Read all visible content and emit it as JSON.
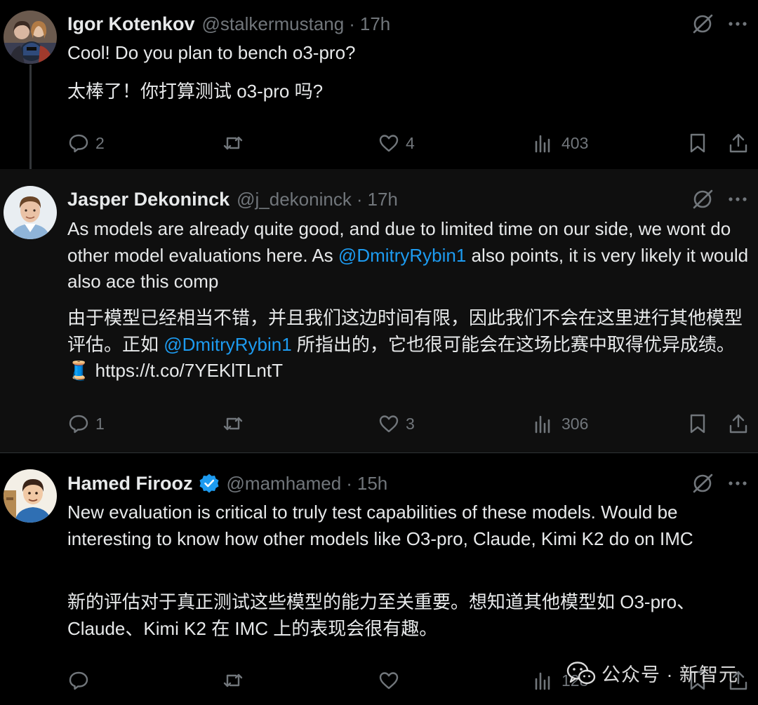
{
  "tweets": [
    {
      "author": "Igor Kotenkov",
      "handle": "@stalkermustang",
      "time": "17h",
      "text_en": "Cool! Do you plan to bench o3-pro?",
      "text_zh": "太棒了！你打算测试 o3-pro 吗?",
      "replies": "2",
      "retweets": "",
      "likes": "4",
      "views": "403"
    },
    {
      "author": "Jasper Dekoninck",
      "handle": "@j_dekoninck",
      "time": "17h",
      "text_en_1": "As models are already quite good, and due to limited time on our side, we wont do other model evaluations here. As",
      "mention_en": "@DmitryRybin1",
      "text_en_2": "also points, it is very likely it would also ace this comp",
      "text_zh_1": "由于模型已经相当不错，并且我们这边时间有限，因此我们不会在这里进行其他模型评估。正如",
      "mention_zh": "@DmitryRybin1",
      "text_zh_2": "所指出的，它也很可能会在这场比赛中取得优异成绩。",
      "emoji": "🧵",
      "link": "https://t.co/7YEKlTLntT",
      "replies": "1",
      "retweets": "",
      "likes": "3",
      "views": "306"
    },
    {
      "author": "Hamed Firooz",
      "handle": "@mamhamed",
      "time": "15h",
      "text_en": "New evaluation is critical to truly test capabilities of these models. Would be interesting to know how other models like O3-pro, Claude, Kimi K2 do on IMC",
      "text_zh": "新的评估对于真正测试这些模型的能力至关重要。想知道其他模型如 O3-pro、Claude、Kimi K2 在 IMC 上的表现会很有趣。",
      "replies": "",
      "retweets": "",
      "likes": "",
      "views": "128"
    }
  ],
  "dot": "·",
  "watermark": "公众号 · 新智元",
  "colors": {
    "background": "#000000",
    "highlight_bg": "#0f0f0f",
    "text": "#e7e9ea",
    "secondary": "#71767b",
    "link": "#1d9bf0",
    "verified": "#1d9bf0",
    "divider": "#2f3336"
  },
  "icons": [
    "reply-icon",
    "retweet-icon",
    "like-icon",
    "views-icon",
    "bookmark-icon",
    "share-icon",
    "grok-icon",
    "more-icon",
    "verified-badge-icon",
    "wechat-icon"
  ]
}
